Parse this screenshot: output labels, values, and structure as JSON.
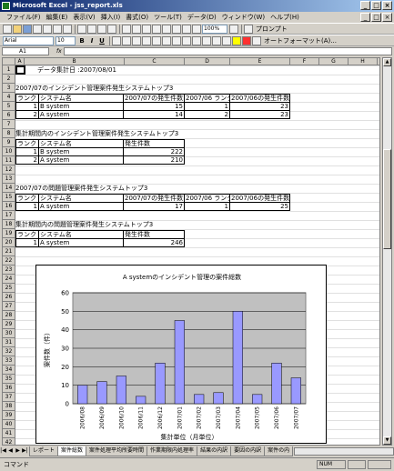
{
  "window": {
    "title": "Microsoft Excel - jss_report.xls",
    "controls": [
      "_",
      "□",
      "×"
    ]
  },
  "menubar": {
    "items": [
      "ファイル(F)",
      "編集(E)",
      "表示(V)",
      "挿入(I)",
      "書式(O)",
      "ツール(T)",
      "データ(D)",
      "ウィンドウ(W)",
      "ヘルプ(H)"
    ]
  },
  "toolbar": {
    "zoom": "100%",
    "prompt_label": "プロンプト",
    "font_name": "Arial",
    "font_size": "10",
    "autoformat_label": "オートフォーマット(A)..."
  },
  "formula_bar": {
    "cell_ref": "A1",
    "fx": "fx",
    "value": ""
  },
  "columns": [
    "A",
    "B",
    "C",
    "D",
    "E",
    "F",
    "G",
    "H",
    "I"
  ],
  "rows": [
    "1",
    "2",
    "3",
    "4",
    "5",
    "6",
    "7",
    "8",
    "9",
    "10",
    "11",
    "12",
    "13",
    "14",
    "15",
    "16",
    "17",
    "18",
    "19",
    "20",
    "21",
    "22",
    "23",
    "24",
    "25",
    "26",
    "27",
    "28",
    "29",
    "30",
    "31",
    "32",
    "33",
    "34",
    "35",
    "36",
    "37",
    "38",
    "39",
    "40",
    "41",
    "42"
  ],
  "sheet": {
    "r1_text": "データ集計日 :2007/08/01",
    "s1": {
      "title": "2007/07のインシデント管理案件発生システムトップ3",
      "headers": [
        "ランク",
        "システム名",
        "2007/07の発生件数",
        "2007/06 ランク",
        "2007/06の発生件数"
      ],
      "rows": [
        [
          "1",
          "B system",
          "15",
          "1",
          "23"
        ],
        [
          "2",
          "A system",
          "14",
          "2",
          "23"
        ]
      ]
    },
    "s2": {
      "title": "集計期間内のインシデント管理案件発生システムトップ3",
      "headers": [
        "ランク",
        "システム名",
        "発生件数"
      ],
      "rows": [
        [
          "1",
          "B system",
          "222"
        ],
        [
          "2",
          "A system",
          "210"
        ]
      ]
    },
    "s3": {
      "title": "2007/07の問題管理案件発生システムトップ3",
      "headers": [
        "ランク",
        "システム名",
        "2007/07の発生件数",
        "2007/06 ランク",
        "2007/06の発生件数"
      ],
      "rows": [
        [
          "1",
          "A system",
          "17",
          "1",
          "25"
        ]
      ]
    },
    "s4": {
      "title": "集計期間内の問題管理案件発生システムトップ3",
      "headers": [
        "ランク",
        "システム名",
        "発生件数"
      ],
      "rows": [
        [
          "1",
          "A system",
          "246"
        ]
      ]
    }
  },
  "chart_data": {
    "type": "bar",
    "title": "A systemのインシデント管理の案件総数",
    "xlabel": "集計単位（月単位）",
    "ylabel": "案件数（件）",
    "ylim": [
      0,
      60
    ],
    "yticks": [
      "0",
      "10",
      "20",
      "30",
      "40",
      "50",
      "60"
    ],
    "categories": [
      "2006/08",
      "2006/09",
      "2006/10",
      "2006/11",
      "2006/12",
      "2007/01",
      "2007/02",
      "2007/03",
      "2007/04",
      "2007/05",
      "2007/06",
      "2007/07"
    ],
    "values": [
      10,
      12,
      15,
      4,
      22,
      45,
      5,
      6,
      50,
      5,
      22,
      14
    ],
    "grid": true,
    "bar_color": "#9999ff",
    "plot_bg": "#c0c0c0"
  },
  "sheet_tabs": {
    "tabs": [
      "レポート",
      "案件総数",
      "案件処理平均所要時間",
      "作業期限内処理率",
      "結果の内訳",
      "要因の内訳",
      "案件の内"
    ],
    "active": "案件総数"
  },
  "status": {
    "text": "コマンド",
    "num": "NUM"
  }
}
